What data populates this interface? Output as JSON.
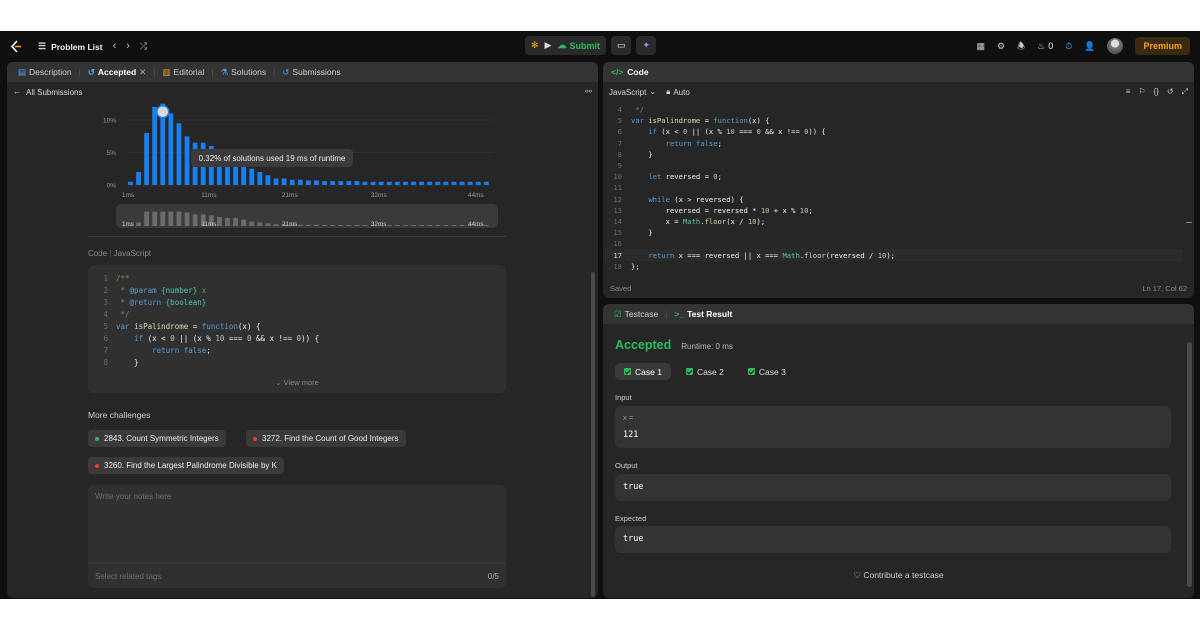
{
  "topbar": {
    "problem_list": "Problem List",
    "submit": "Submit",
    "streak": "0",
    "premium": "Premium"
  },
  "left": {
    "tabs": [
      "Description",
      "Accepted",
      "Editorial",
      "Solutions",
      "Submissions"
    ],
    "all_submissions": "All Submissions",
    "tooltip": "0.32% of solutions used 19 ms of runtime",
    "code_label": "Code",
    "code_lang": "JavaScript",
    "code_lines": [
      {
        "n": "1",
        "t": "/**"
      },
      {
        "n": "2",
        "t": " * @param {number} x"
      },
      {
        "n": "3",
        "t": " * @return {boolean}"
      },
      {
        "n": "4",
        "t": " */"
      },
      {
        "n": "5",
        "t": "var isPalindrome = function(x) {"
      },
      {
        "n": "6",
        "t": "    if (x < 0 || (x % 10 === 0 && x !== 0)) {"
      },
      {
        "n": "7",
        "t": "        return false;"
      },
      {
        "n": "8",
        "t": "    }"
      }
    ],
    "view_more": "View more",
    "more_challenges": "More challenges",
    "challenges": [
      {
        "label": "2843. Count Symmetric Integers",
        "color": "#2cbb5d"
      },
      {
        "label": "3272. Find the Count of Good Integers",
        "color": "#f63737"
      },
      {
        "label": "3260. Find the Largest Palindrome Divisible by K",
        "color": "#f63737"
      }
    ],
    "notes_placeholder": "Write your notes here",
    "tags_placeholder": "Select related tags",
    "tags_count": "0/5"
  },
  "chart_data": {
    "type": "bar",
    "title": "",
    "yticks": [
      "10%",
      "5%",
      "0%"
    ],
    "ylim": [
      0,
      12
    ],
    "xticks": [
      "1ms",
      "11ms",
      "21ms",
      "32ms",
      "44ms"
    ],
    "values": [
      0.5,
      2,
      8,
      12,
      12.5,
      11,
      9.5,
      7.5,
      6.5,
      6.5,
      6,
      5,
      4.5,
      4.5,
      3.5,
      2.5,
      2,
      1.5,
      1,
      1,
      0.8,
      0.8,
      0.7,
      0.7,
      0.6,
      0.6,
      0.6,
      0.6,
      0.6,
      0.5,
      0.5,
      0.5,
      0.5,
      0.5,
      0.5,
      0.5,
      0.5,
      0.5,
      0.5,
      0.5,
      0.5,
      0.5,
      0.5,
      0.5,
      0.5
    ],
    "highlight_index": 4,
    "overview_xticks": [
      "1ms",
      "11ms",
      "21ms",
      "32ms",
      "44ms"
    ]
  },
  "editor": {
    "title": "Code",
    "language": "JavaScript",
    "mode": "Auto",
    "lines": [
      {
        "n": "4",
        "t": " */"
      },
      {
        "n": "5",
        "t": "var isPalindrome = function(x) {"
      },
      {
        "n": "6",
        "t": "    if (x < 0 || (x % 10 === 0 && x !== 0)) {"
      },
      {
        "n": "7",
        "t": "        return false;"
      },
      {
        "n": "8",
        "t": "    }"
      },
      {
        "n": "9",
        "t": ""
      },
      {
        "n": "10",
        "t": "    let reversed = 0;"
      },
      {
        "n": "11",
        "t": ""
      },
      {
        "n": "12",
        "t": "    while (x > reversed) {"
      },
      {
        "n": "13",
        "t": "        reversed = reversed * 10 + x % 10;"
      },
      {
        "n": "14",
        "t": "        x = Math.floor(x / 10);"
      },
      {
        "n": "15",
        "t": "    }"
      },
      {
        "n": "16",
        "t": ""
      },
      {
        "n": "17",
        "t": "    return x === reversed || x === Math.floor(reversed / 10);"
      },
      {
        "n": "18",
        "t": "};"
      }
    ],
    "status": "Saved",
    "cursor": "Ln 17, Col 62"
  },
  "result": {
    "tab_testcase": "Testcase",
    "tab_result": "Test Result",
    "status": "Accepted",
    "runtime": "Runtime: 0 ms",
    "cases": [
      "Case 1",
      "Case 2",
      "Case 3"
    ],
    "input_label": "Input",
    "input_var": "x =",
    "input_value": "121",
    "output_label": "Output",
    "output_value": "true",
    "expected_label": "Expected",
    "expected_value": "true",
    "contribute": "Contribute a testcase"
  },
  "colors": {
    "accent": "#2cbb5d",
    "bar": "#1a7df0",
    "premium": "#ffa116"
  }
}
